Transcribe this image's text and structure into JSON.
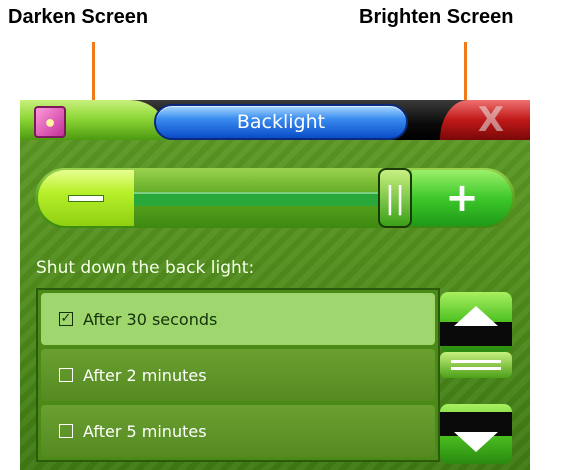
{
  "annotations": {
    "darken_label": "Darken Screen",
    "brighten_label": "Brighten Screen",
    "arrow_color": "#f07a1a"
  },
  "header": {
    "app_icon": "lightbulb-icon",
    "title": "Backlight",
    "close_symbol": "X"
  },
  "slider": {
    "minus_symbol": "—",
    "plus_symbol": "+",
    "thumb_symbol": "||",
    "level_percent": 90
  },
  "section": {
    "label": "Shut down the back light:"
  },
  "list": {
    "items": [
      {
        "label": "After 30 seconds",
        "checked": true
      },
      {
        "label": "After 2 minutes",
        "checked": false
      },
      {
        "label": "After 5 minutes",
        "checked": false
      }
    ]
  },
  "colors": {
    "panel_green": "#4d8a1a",
    "selected_item": "#9fd66e",
    "title_blue": "#3a8cf0",
    "close_red": "#c01818"
  }
}
